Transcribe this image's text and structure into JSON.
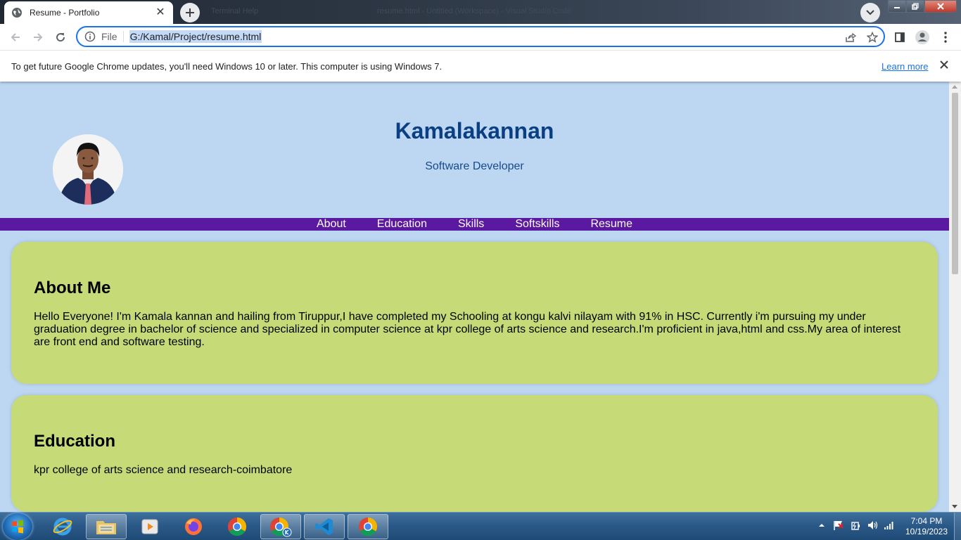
{
  "browser": {
    "tab_title": "Resume - Portfolio",
    "background_window_title": "resume.html - Untitled (Workspace) - Visual Studio Code",
    "background_window_hint": "Terminal   Help",
    "url_chip": "File",
    "url": "G:/Kamal/Project/resume.html"
  },
  "infobar": {
    "message": "To get future Google Chrome updates, you'll need Windows 10 or later. This computer is using Windows 7.",
    "learn_more": "Learn more"
  },
  "page": {
    "name": "Kamalakannan",
    "role": "Software Developer",
    "nav": [
      "About",
      "Education",
      "Skills",
      "Softskills",
      "Resume"
    ],
    "about": {
      "heading": "About Me",
      "text": "Hello Everyone! I'm Kamala kannan and hailing from Tiruppur,I have completed my Schooling at kongu kalvi nilayam with 91% in HSC. Currently i'm pursuing my under graduation degree in bachelor of science and specialized in computer science at kpr college of arts science and research.I'm proficient in java,html and css.My area of interest are front end and software testing."
    },
    "education": {
      "heading": "Education",
      "text": "kpr college of arts science and research-coimbatore"
    }
  },
  "taskbar": {
    "time": "7:04 PM",
    "date": "10/19/2023"
  },
  "colors": {
    "page_bg": "#bdd7f2",
    "nav_bg": "#5b18a0",
    "card_bg": "#c6da78",
    "name_color": "#0b3f84"
  }
}
